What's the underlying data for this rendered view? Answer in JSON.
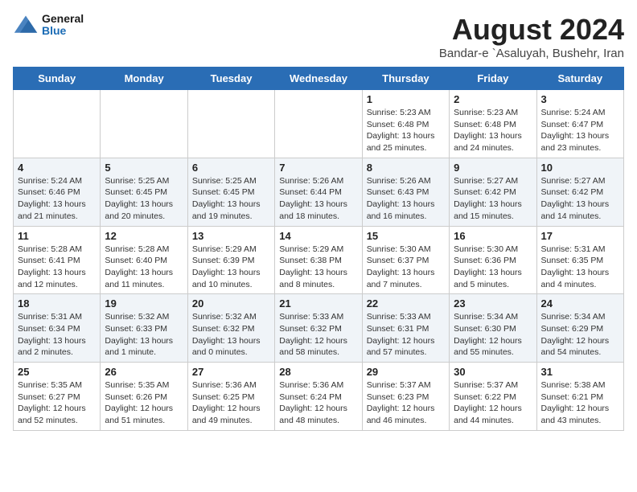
{
  "header": {
    "logo_general": "General",
    "logo_blue": "Blue",
    "month_year": "August 2024",
    "location": "Bandar-e `Asaluyah, Bushehr, Iran"
  },
  "weekdays": [
    "Sunday",
    "Monday",
    "Tuesday",
    "Wednesday",
    "Thursday",
    "Friday",
    "Saturday"
  ],
  "weeks": [
    [
      {
        "day": "",
        "info": ""
      },
      {
        "day": "",
        "info": ""
      },
      {
        "day": "",
        "info": ""
      },
      {
        "day": "",
        "info": ""
      },
      {
        "day": "1",
        "info": "Sunrise: 5:23 AM\nSunset: 6:48 PM\nDaylight: 13 hours and 25 minutes."
      },
      {
        "day": "2",
        "info": "Sunrise: 5:23 AM\nSunset: 6:48 PM\nDaylight: 13 hours and 24 minutes."
      },
      {
        "day": "3",
        "info": "Sunrise: 5:24 AM\nSunset: 6:47 PM\nDaylight: 13 hours and 23 minutes."
      }
    ],
    [
      {
        "day": "4",
        "info": "Sunrise: 5:24 AM\nSunset: 6:46 PM\nDaylight: 13 hours and 21 minutes."
      },
      {
        "day": "5",
        "info": "Sunrise: 5:25 AM\nSunset: 6:45 PM\nDaylight: 13 hours and 20 minutes."
      },
      {
        "day": "6",
        "info": "Sunrise: 5:25 AM\nSunset: 6:45 PM\nDaylight: 13 hours and 19 minutes."
      },
      {
        "day": "7",
        "info": "Sunrise: 5:26 AM\nSunset: 6:44 PM\nDaylight: 13 hours and 18 minutes."
      },
      {
        "day": "8",
        "info": "Sunrise: 5:26 AM\nSunset: 6:43 PM\nDaylight: 13 hours and 16 minutes."
      },
      {
        "day": "9",
        "info": "Sunrise: 5:27 AM\nSunset: 6:42 PM\nDaylight: 13 hours and 15 minutes."
      },
      {
        "day": "10",
        "info": "Sunrise: 5:27 AM\nSunset: 6:42 PM\nDaylight: 13 hours and 14 minutes."
      }
    ],
    [
      {
        "day": "11",
        "info": "Sunrise: 5:28 AM\nSunset: 6:41 PM\nDaylight: 13 hours and 12 minutes."
      },
      {
        "day": "12",
        "info": "Sunrise: 5:28 AM\nSunset: 6:40 PM\nDaylight: 13 hours and 11 minutes."
      },
      {
        "day": "13",
        "info": "Sunrise: 5:29 AM\nSunset: 6:39 PM\nDaylight: 13 hours and 10 minutes."
      },
      {
        "day": "14",
        "info": "Sunrise: 5:29 AM\nSunset: 6:38 PM\nDaylight: 13 hours and 8 minutes."
      },
      {
        "day": "15",
        "info": "Sunrise: 5:30 AM\nSunset: 6:37 PM\nDaylight: 13 hours and 7 minutes."
      },
      {
        "day": "16",
        "info": "Sunrise: 5:30 AM\nSunset: 6:36 PM\nDaylight: 13 hours and 5 minutes."
      },
      {
        "day": "17",
        "info": "Sunrise: 5:31 AM\nSunset: 6:35 PM\nDaylight: 13 hours and 4 minutes."
      }
    ],
    [
      {
        "day": "18",
        "info": "Sunrise: 5:31 AM\nSunset: 6:34 PM\nDaylight: 13 hours and 2 minutes."
      },
      {
        "day": "19",
        "info": "Sunrise: 5:32 AM\nSunset: 6:33 PM\nDaylight: 13 hours and 1 minute."
      },
      {
        "day": "20",
        "info": "Sunrise: 5:32 AM\nSunset: 6:32 PM\nDaylight: 13 hours and 0 minutes."
      },
      {
        "day": "21",
        "info": "Sunrise: 5:33 AM\nSunset: 6:32 PM\nDaylight: 12 hours and 58 minutes."
      },
      {
        "day": "22",
        "info": "Sunrise: 5:33 AM\nSunset: 6:31 PM\nDaylight: 12 hours and 57 minutes."
      },
      {
        "day": "23",
        "info": "Sunrise: 5:34 AM\nSunset: 6:30 PM\nDaylight: 12 hours and 55 minutes."
      },
      {
        "day": "24",
        "info": "Sunrise: 5:34 AM\nSunset: 6:29 PM\nDaylight: 12 hours and 54 minutes."
      }
    ],
    [
      {
        "day": "25",
        "info": "Sunrise: 5:35 AM\nSunset: 6:27 PM\nDaylight: 12 hours and 52 minutes."
      },
      {
        "day": "26",
        "info": "Sunrise: 5:35 AM\nSunset: 6:26 PM\nDaylight: 12 hours and 51 minutes."
      },
      {
        "day": "27",
        "info": "Sunrise: 5:36 AM\nSunset: 6:25 PM\nDaylight: 12 hours and 49 minutes."
      },
      {
        "day": "28",
        "info": "Sunrise: 5:36 AM\nSunset: 6:24 PM\nDaylight: 12 hours and 48 minutes."
      },
      {
        "day": "29",
        "info": "Sunrise: 5:37 AM\nSunset: 6:23 PM\nDaylight: 12 hours and 46 minutes."
      },
      {
        "day": "30",
        "info": "Sunrise: 5:37 AM\nSunset: 6:22 PM\nDaylight: 12 hours and 44 minutes."
      },
      {
        "day": "31",
        "info": "Sunrise: 5:38 AM\nSunset: 6:21 PM\nDaylight: 12 hours and 43 minutes."
      }
    ]
  ]
}
